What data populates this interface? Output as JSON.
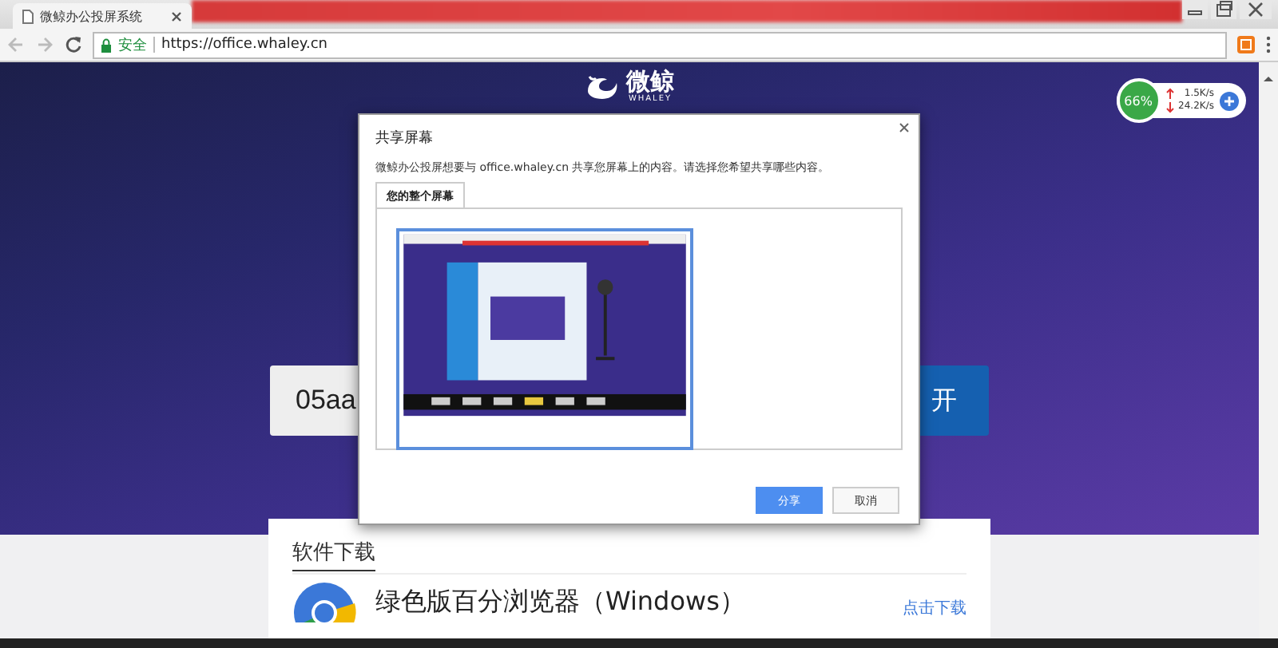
{
  "browser": {
    "tabs": [
      {
        "title": "微鲸办公投屏系统",
        "selected": true
      }
    ],
    "security": "安全",
    "url": "https://office.whaley.cn"
  },
  "page": {
    "logo": {
      "name": "微鲸",
      "subtitle": "WHALEY"
    },
    "code_field": {
      "value": "05aa"
    },
    "open_button": "开",
    "download_card": {
      "heading": "软件下载",
      "items": [
        {
          "name": "绿色版百分浏览器（Windows）",
          "link": "点击下载"
        }
      ]
    }
  },
  "speed_widget": {
    "percent": "66%",
    "upload": "1.5K/s",
    "download": "24.2K/s"
  },
  "dialog": {
    "title": "共享屏幕",
    "message": "微鲸办公投屏想要与 office.whaley.cn 共享您屏幕上的内容。请选择您希望共享哪些内容。",
    "tabs": [
      {
        "label": "您的整个屏幕",
        "selected": true
      }
    ],
    "sources": [
      {
        "selected": true
      }
    ],
    "buttons": [
      {
        "label": "分享",
        "kind": "primary"
      },
      {
        "label": "取消",
        "kind": "secondary"
      }
    ]
  }
}
